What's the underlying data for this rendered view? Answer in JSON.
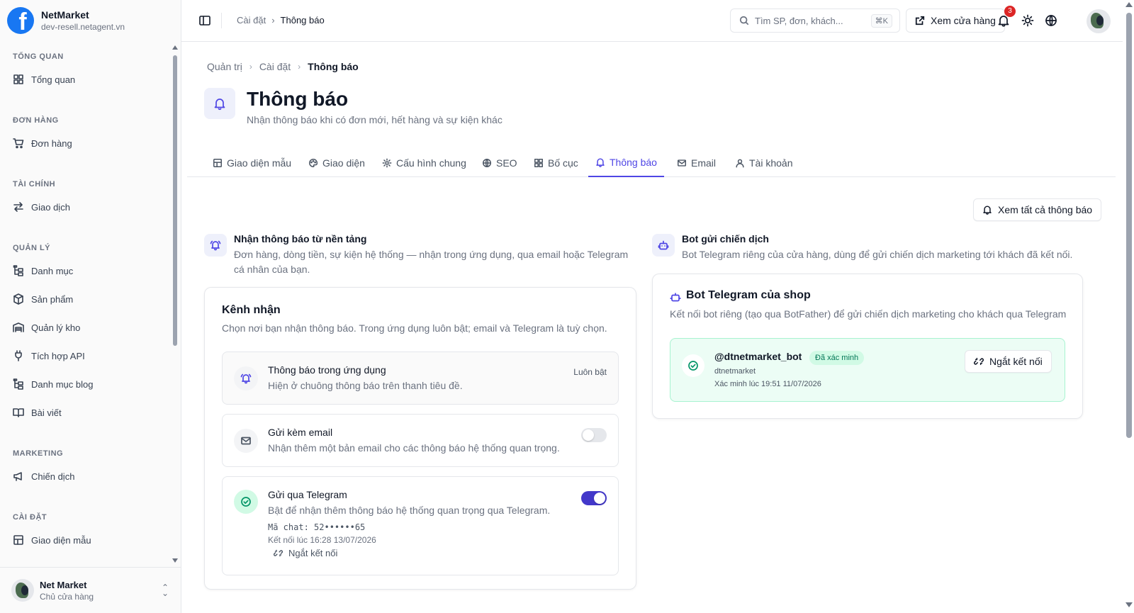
{
  "brand": {
    "name": "NetMarket",
    "domain": "dev-resell.netagent.vn",
    "logo_letter": "f"
  },
  "sidebar": {
    "sections": [
      {
        "title": "TỔNG QUAN",
        "items": [
          {
            "label": "Tổng quan",
            "icon": "grid-icon"
          }
        ]
      },
      {
        "title": "ĐƠN HÀNG",
        "items": [
          {
            "label": "Đơn hàng",
            "icon": "cart-icon"
          }
        ]
      },
      {
        "title": "TÀI CHÍNH",
        "items": [
          {
            "label": "Giao dịch",
            "icon": "arrows-icon"
          }
        ]
      },
      {
        "title": "QUẢN LÝ",
        "items": [
          {
            "label": "Danh mục",
            "icon": "tree-icon"
          },
          {
            "label": "Sản phẩm",
            "icon": "package-icon"
          },
          {
            "label": "Quản lý kho",
            "icon": "warehouse-icon"
          },
          {
            "label": "Tích hợp API",
            "icon": "plug-icon"
          },
          {
            "label": "Danh mục blog",
            "icon": "tree-icon"
          },
          {
            "label": "Bài viết",
            "icon": "book-icon"
          }
        ]
      },
      {
        "title": "MARKETING",
        "items": [
          {
            "label": "Chiến dịch",
            "icon": "megaphone-icon"
          }
        ]
      },
      {
        "title": "CÀI ĐẶT",
        "items": [
          {
            "label": "Giao diện mẫu",
            "icon": "layout-icon"
          }
        ]
      }
    ]
  },
  "user": {
    "name": "Net Market",
    "role": "Chủ cửa hàng"
  },
  "topbar": {
    "breadcrumb": [
      "Cài đặt",
      "Thông báo"
    ],
    "search_placeholder": "Tìm SP, đơn, khách...",
    "search_shortcut": "⌘K",
    "view_store_label": "Xem cửa hàng",
    "notification_count": "3"
  },
  "page": {
    "breadcrumb": [
      "Quản trị",
      "Cài đặt",
      "Thông báo"
    ],
    "title": "Thông báo",
    "subtitle": "Nhận thông báo khi có đơn mới, hết hàng và sự kiện khác"
  },
  "tabs": [
    {
      "label": "Giao diện mẫu",
      "icon": "layout-icon",
      "active": false
    },
    {
      "label": "Giao diện",
      "icon": "palette-icon",
      "active": false
    },
    {
      "label": "Cấu hình chung",
      "icon": "gear-icon",
      "active": false
    },
    {
      "label": "SEO",
      "icon": "globe-icon",
      "active": false
    },
    {
      "label": "Bố cục",
      "icon": "grid-icon",
      "active": false
    },
    {
      "label": "Thông báo",
      "icon": "bell-icon",
      "active": true
    },
    {
      "label": "Email",
      "icon": "mail-icon",
      "active": false
    },
    {
      "label": "Tài khoản",
      "icon": "user-icon",
      "active": false
    }
  ],
  "view_all_label": "Xem tất cả thông báo",
  "platform": {
    "title": "Nhận thông báo từ nền tảng",
    "desc": "Đơn hàng, dòng tiền, sự kiện hệ thống — nhận trong ứng dụng, qua email hoặc Telegram cá nhân của bạn.",
    "card_title": "Kênh nhận",
    "card_desc": "Chọn nơi bạn nhận thông báo. Trong ứng dụng luôn bật; email và Telegram là tuỳ chọn.",
    "channels": {
      "inapp": {
        "title": "Thông báo trong ứng dụng",
        "desc": "Hiện ở chuông thông báo trên thanh tiêu đề.",
        "status": "Luôn bật"
      },
      "email": {
        "title": "Gửi kèm email",
        "desc": "Nhận thêm một bản email cho các thông báo hệ thống quan trọng.",
        "enabled": false
      },
      "telegram": {
        "title": "Gửi qua Telegram",
        "desc": "Bật để nhận thêm thông báo hệ thống quan trọng qua Telegram.",
        "enabled": true,
        "chat_id": "Mã chat: 52••••••65",
        "connected_at": "Kết nối lúc 16:28 13/07/2026",
        "disconnect_label": "Ngắt kết nối"
      }
    }
  },
  "campaign_bot": {
    "title": "Bot gửi chiến dịch",
    "desc": "Bot Telegram riêng của cửa hàng, dùng để gửi chiến dịch marketing tới khách đã kết nối.",
    "card_title": "Bot Telegram của shop",
    "card_desc": "Kết nối bot riêng (tạo qua BotFather) để gửi chiến dịch marketing cho khách qua Telegram",
    "bot_handle": "@dtnetmarket_bot",
    "verified_badge": "Đã xác minh",
    "bot_username": "dtnetmarket",
    "verified_at": "Xác minh lúc 19:51 11/07/2026",
    "disconnect_label": "Ngắt kết nối"
  },
  "colors": {
    "accent": "#4f46e5",
    "brand": "#1877f2",
    "success": "#059669",
    "badge": "#dc2626"
  }
}
